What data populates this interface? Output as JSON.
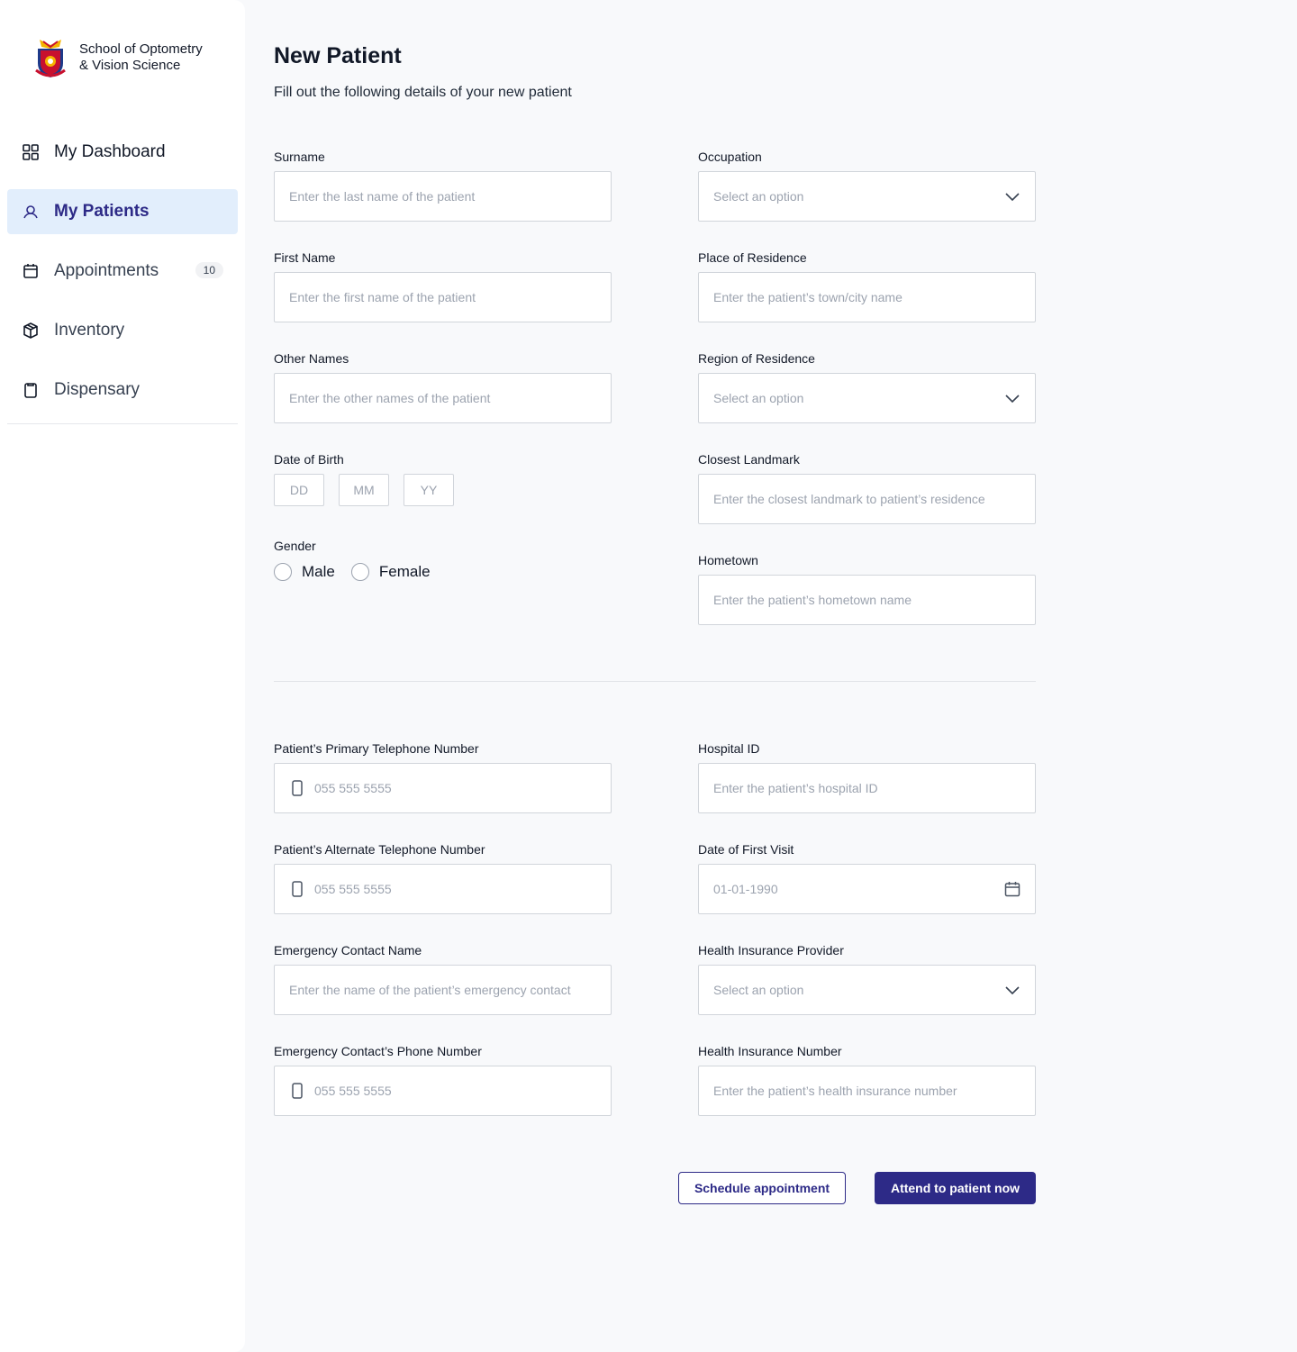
{
  "sidebar": {
    "logo_line1": "School of Optometry",
    "logo_line2": "& Vision Science",
    "items": [
      {
        "label": "My Dashboard",
        "icon": "grid-icon"
      },
      {
        "label": "My Patients",
        "icon": "patient-icon",
        "active": true
      },
      {
        "label": "Appointments",
        "icon": "calendar-icon",
        "badge": "10"
      },
      {
        "label": "Inventory",
        "icon": "box-icon"
      },
      {
        "label": "Dispensary",
        "icon": "clipboard-icon"
      }
    ]
  },
  "header": {
    "title": "New Patient",
    "subtitle": "Fill out the following details of your new patient"
  },
  "form": {
    "surname": {
      "label": "Surname",
      "placeholder": "Enter the last name of the patient"
    },
    "first_name": {
      "label": "First Name",
      "placeholder": "Enter the first name of the patient"
    },
    "other_names": {
      "label": "Other Names",
      "placeholder": "Enter the other names of the patient"
    },
    "dob": {
      "label": "Date of Birth",
      "dd": "DD",
      "mm": "MM",
      "yy": "YY"
    },
    "gender": {
      "label": "Gender",
      "male": "Male",
      "female": "Female"
    },
    "occupation": {
      "label": "Occupation",
      "placeholder": "Select an option"
    },
    "place_of_residence": {
      "label": "Place of Residence",
      "placeholder": "Enter the patient’s town/city name"
    },
    "region_of_residence": {
      "label": "Region of Residence",
      "placeholder": "Select an option"
    },
    "closest_landmark": {
      "label": "Closest Landmark",
      "placeholder": "Enter the closest landmark to patient’s residence"
    },
    "hometown": {
      "label": "Hometown",
      "placeholder": "Enter the patient’s hometown name"
    },
    "primary_phone": {
      "label": "Patient’s Primary Telephone Number",
      "placeholder": "055 555 5555"
    },
    "alternate_phone": {
      "label": "Patient’s Alternate Telephone Number",
      "placeholder": "055 555 5555"
    },
    "emergency_name": {
      "label": "Emergency Contact Name",
      "placeholder": "Enter the name of the patient’s emergency contact"
    },
    "emergency_phone": {
      "label": "Emergency Contact’s Phone Number",
      "placeholder": "055 555 5555"
    },
    "hospital_id": {
      "label": "Hospital ID",
      "placeholder": "Enter the patient’s hospital ID"
    },
    "first_visit": {
      "label": "Date of First Visit",
      "placeholder": "01-01-1990"
    },
    "insurance_provider": {
      "label": "Health Insurance Provider",
      "placeholder": "Select an option"
    },
    "insurance_number": {
      "label": "Health Insurance Number",
      "placeholder": "Enter the patient’s health insurance number"
    }
  },
  "actions": {
    "schedule": "Schedule appointment",
    "attend": "Attend to patient now"
  },
  "colors": {
    "accent": "#2d2a87",
    "active_bg": "#e2eefc",
    "page_bg": "#f8f9fb"
  }
}
